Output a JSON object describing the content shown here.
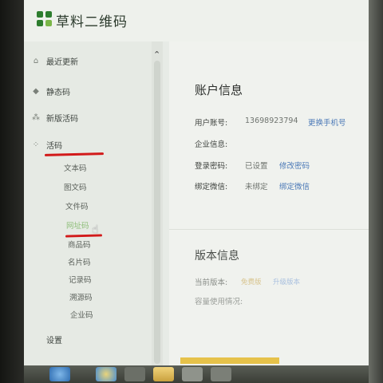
{
  "app": {
    "brand": "草料二维码"
  },
  "sidebar": {
    "items": [
      {
        "label": "最近更新",
        "icon": "home-icon"
      },
      {
        "label": "静态码",
        "icon": "diamond-icon"
      },
      {
        "label": "新版活码",
        "icon": "grid-icon"
      },
      {
        "label": "活码",
        "icon": "grid-icon"
      }
    ],
    "subitems": [
      "文本码",
      "图文码",
      "文件码",
      "网址码",
      "商品码",
      "名片码",
      "记录码",
      "溯源码",
      "企业码"
    ],
    "active_subitem": "网址码",
    "bottom_item": "设置"
  },
  "account": {
    "title": "账户信息",
    "phone_label": "用户账号:",
    "phone_value": "13698923794",
    "change_phone": "更换手机号",
    "company_label": "企业信息:",
    "password_label": "登录密码:",
    "password_status": "已设置",
    "change_password": "修改密码",
    "wechat_label": "绑定微信:",
    "wechat_status": "未绑定",
    "bind_wechat": "绑定微信"
  },
  "version": {
    "title": "版本信息",
    "current_label": "当前版本:",
    "current_value": "免费版",
    "upgrade": "升级版本",
    "usage_label": "容量使用情况:"
  },
  "colors": {
    "brand_green": "#2d7d2e",
    "link_blue": "#4b79b7",
    "annotation_red": "#d21a1a",
    "active_green": "#8fbf7b"
  }
}
